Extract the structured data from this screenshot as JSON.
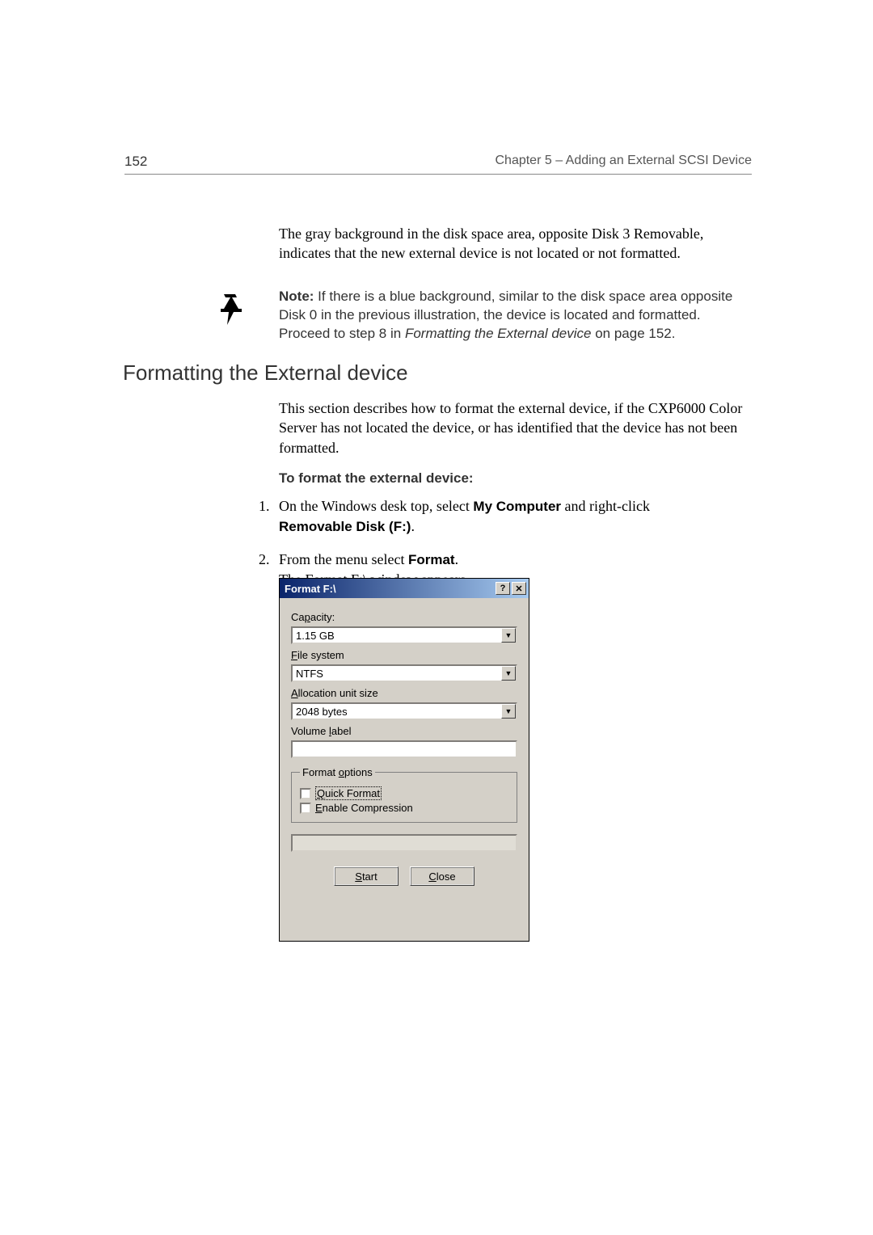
{
  "header": {
    "page_number": "152",
    "chapter": "Chapter 5 – Adding an External SCSI Device"
  },
  "intro": "The gray background in the disk space area, opposite Disk 3 Removable, indicates that the new external device is not located or not formatted.",
  "note": {
    "label": "Note:",
    "body_before_italic": "  If there is a blue background, similar to the disk space area opposite Disk 0 in the previous illustration, the device is located and formatted. Proceed to step 8 in ",
    "italic": "Formatting the External device",
    "body_after_italic": " on page 152."
  },
  "section": {
    "heading": "Formatting the External device",
    "body": "This section describes how to format the external device, if the CXP6000 Color Server has not located the device, or has identified that the device has not been formatted.",
    "procedure_title": "To format the external device:",
    "steps": [
      {
        "num": "1.",
        "pre": "On the Windows desk top, select ",
        "bold1": "My Computer",
        "mid": " and right-click ",
        "bold2": "Removable Disk (F:)",
        "post": "."
      },
      {
        "num": "2.",
        "pre": "From the menu select ",
        "bold1": "Format",
        "mid": ".",
        "line2": "The Format F:\\ window appears."
      }
    ]
  },
  "dialog": {
    "title": "Format F:\\",
    "help": "?",
    "close": "✕",
    "labels": {
      "capacity": {
        "pre": "Ca",
        "u": "p",
        "post": "acity:"
      },
      "filesystem": {
        "u": "F",
        "post": "ile system"
      },
      "allocation": {
        "u": "A",
        "post": "llocation unit size"
      },
      "volume": {
        "pre": "Volume ",
        "u": "l",
        "post": "abel"
      },
      "options": {
        "pre": "Format ",
        "u": "o",
        "post": "ptions"
      },
      "quick": {
        "u": "Q",
        "post": "uick Format"
      },
      "compression": {
        "u": "E",
        "post": "nable Compression"
      }
    },
    "capacity_value": "1.15 GB",
    "filesystem_value": "NTFS",
    "allocation_value": "2048 bytes",
    "volume_value": "",
    "buttons": {
      "start": {
        "u": "S",
        "post": "tart"
      },
      "close": {
        "u": "C",
        "post": "lose"
      }
    }
  }
}
